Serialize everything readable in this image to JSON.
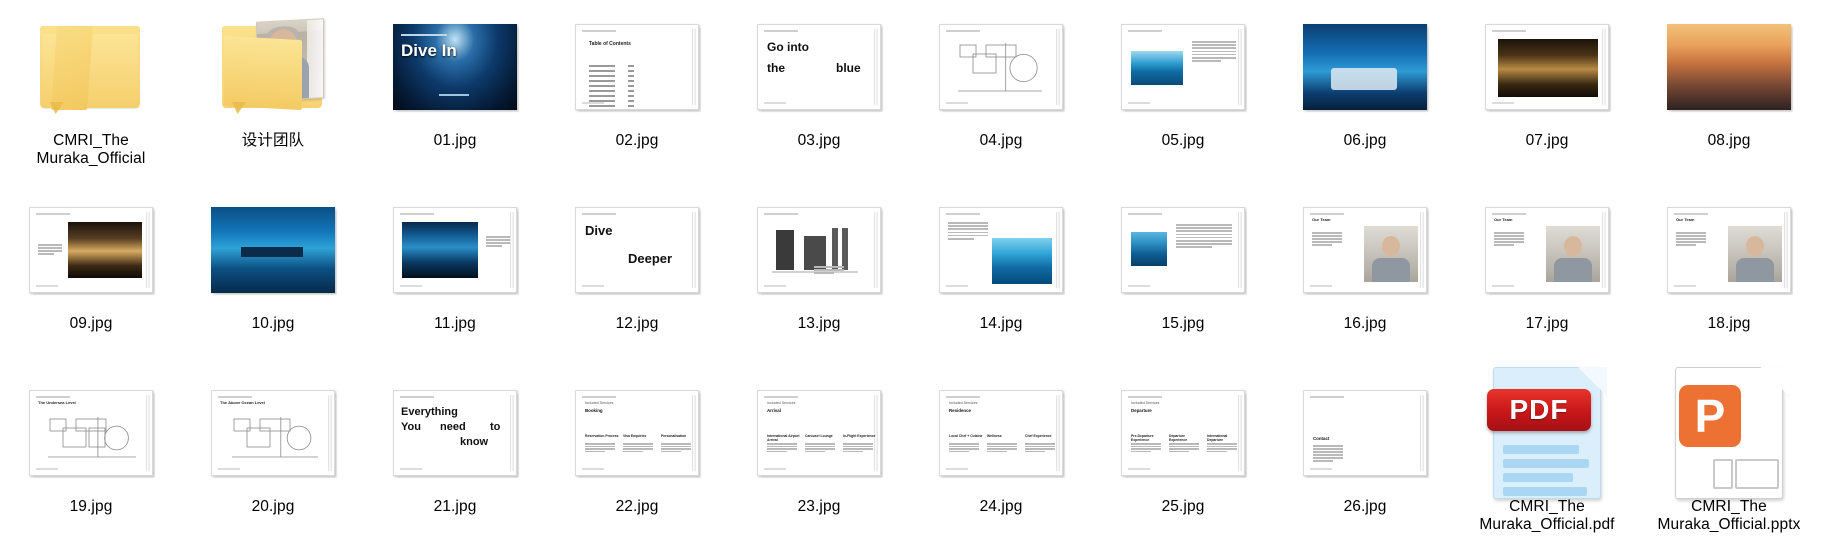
{
  "view": {
    "name": "file-explorer-extra-large-icons",
    "background": "#ffffff",
    "columns": 10,
    "rows": 3
  },
  "colors": {
    "folder_yellow": "#f7d274",
    "pdf_red": "#c8171a",
    "pptx_orange": "#ed7133",
    "label_text": "#000000",
    "slide_border": "#d9d9d9"
  },
  "items": [
    {
      "label": "CMRI_The Muraka_Official",
      "icon": "folder-icon",
      "kind": "folder"
    },
    {
      "label": "设计团队",
      "icon": "folder-open-with-preview-icon",
      "kind": "folder"
    },
    {
      "label": "01.jpg",
      "icon": "image-thumbnail",
      "kind": "image",
      "slide": "cover-dive-in"
    },
    {
      "label": "02.jpg",
      "icon": "image-thumbnail",
      "kind": "image",
      "slide": "table-of-contents"
    },
    {
      "label": "03.jpg",
      "icon": "image-thumbnail",
      "kind": "image",
      "slide": "go-into-the-blue"
    },
    {
      "label": "04.jpg",
      "icon": "image-thumbnail",
      "kind": "image",
      "slide": "floor-plan"
    },
    {
      "label": "05.jpg",
      "icon": "image-thumbnail",
      "kind": "image",
      "slide": "aerial-photo-text"
    },
    {
      "label": "06.jpg",
      "icon": "image-thumbnail",
      "kind": "image",
      "slide": "underwater-bedroom"
    },
    {
      "label": "07.jpg",
      "icon": "image-thumbnail",
      "kind": "image",
      "slide": "warm-corridor"
    },
    {
      "label": "08.jpg",
      "icon": "image-thumbnail",
      "kind": "image",
      "slide": "sunset-deck"
    },
    {
      "label": "09.jpg",
      "icon": "image-thumbnail",
      "kind": "image",
      "slide": "spa-interior"
    },
    {
      "label": "10.jpg",
      "icon": "image-thumbnail",
      "kind": "image",
      "slide": "underwater-dining"
    },
    {
      "label": "11.jpg",
      "icon": "image-thumbnail",
      "kind": "image",
      "slide": "curved-glass-lounge"
    },
    {
      "label": "12.jpg",
      "icon": "image-thumbnail",
      "kind": "image",
      "slide": "dive-deeper"
    },
    {
      "label": "13.jpg",
      "icon": "image-thumbnail",
      "kind": "image",
      "slide": "section-drawing"
    },
    {
      "label": "14.jpg",
      "icon": "image-thumbnail",
      "kind": "image",
      "slide": "ocean-view-text"
    },
    {
      "label": "15.jpg",
      "icon": "image-thumbnail",
      "kind": "image",
      "slide": "pod-structure"
    },
    {
      "label": "16.jpg",
      "icon": "image-thumbnail",
      "kind": "image",
      "slide": "team-member-1"
    },
    {
      "label": "17.jpg",
      "icon": "image-thumbnail",
      "kind": "image",
      "slide": "team-member-2"
    },
    {
      "label": "18.jpg",
      "icon": "image-thumbnail",
      "kind": "image",
      "slide": "team-member-3"
    },
    {
      "label": "19.jpg",
      "icon": "image-thumbnail",
      "kind": "image",
      "slide": "undersea-level-plan"
    },
    {
      "label": "20.jpg",
      "icon": "image-thumbnail",
      "kind": "image",
      "slide": "above-ocean-level-plan"
    },
    {
      "label": "21.jpg",
      "icon": "image-thumbnail",
      "kind": "image",
      "slide": "everything-you-need-to-know"
    },
    {
      "label": "22.jpg",
      "icon": "image-thumbnail",
      "kind": "image",
      "slide": "included-services-booking"
    },
    {
      "label": "23.jpg",
      "icon": "image-thumbnail",
      "kind": "image",
      "slide": "included-services-arrival"
    },
    {
      "label": "24.jpg",
      "icon": "image-thumbnail",
      "kind": "image",
      "slide": "included-services-residence"
    },
    {
      "label": "25.jpg",
      "icon": "image-thumbnail",
      "kind": "image",
      "slide": "included-services-departure"
    },
    {
      "label": "26.jpg",
      "icon": "image-thumbnail",
      "kind": "image",
      "slide": "contact"
    },
    {
      "label": "CMRI_The Muraka_Official.pdf",
      "icon": "pdf-file-icon",
      "kind": "pdf",
      "badge": "PDF"
    },
    {
      "label": "CMRI_The Muraka_Official.pptx",
      "icon": "powerpoint-file-icon",
      "kind": "pptx",
      "badge": "P"
    }
  ],
  "slide_text": {
    "cover_title": "Dive In",
    "toc_title": "Table of Contents",
    "toc_entries": [
      {
        "name": "Introduction",
        "page": "2"
      },
      {
        "name": "Immersion",
        "page": "6"
      },
      {
        "name": "Design",
        "page": "12"
      },
      {
        "name": "The Team",
        "page": "16"
      },
      {
        "name": "Floorplans",
        "page": "19"
      },
      {
        "name": "Booking",
        "page": "22"
      },
      {
        "name": "Arrival",
        "page": "23"
      },
      {
        "name": "Residence",
        "page": "24"
      },
      {
        "name": "Departure",
        "page": "25"
      },
      {
        "name": "Contact",
        "page": "26"
      }
    ],
    "go_into_line1": "Go into",
    "go_into_line2a": "the",
    "go_into_line2b": "blue",
    "dive_line1": "Dive",
    "dive_line2": "Deeper",
    "everything_line1": "Everything",
    "everything_line2a": "You",
    "everything_line2b": "need",
    "everything_line2c": "to",
    "everything_line3": "know",
    "services_kicker": "Included Services",
    "services_booking": "Booking",
    "services_arrival": "Arrival",
    "services_residence": "Residence",
    "services_departure": "Departure",
    "booking_cols": [
      "Reservation Process",
      "Visa Enquiries",
      "Personalisation"
    ],
    "arrival_cols": [
      "International Airport Arrival",
      "Carousel Lounge",
      "In-Flight Experience"
    ],
    "residence_cols": [
      "Local Chef + Cuisine",
      "Wellness",
      "Chef Experience"
    ],
    "departure_cols": [
      "Pre-Departure Experience",
      "Departure Experience",
      "International Departure"
    ],
    "contact_title": "Contact",
    "section_title_undersea": "The Undersea Level",
    "section_title_above": "The Above Ocean Level",
    "team_title": "Our Team"
  }
}
